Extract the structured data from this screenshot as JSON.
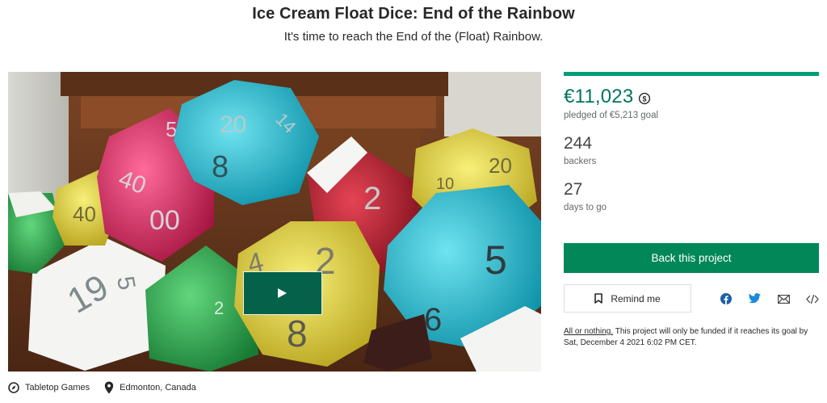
{
  "project": {
    "title": "Ice Cream Float Dice: End of the Rainbow",
    "blurb": "It's time to reach the End of the (Float) Rainbow."
  },
  "video": {
    "play_icon": "play-icon"
  },
  "category": {
    "icon": "compass-icon",
    "label": "Tabletop Games"
  },
  "location": {
    "icon": "map-pin-icon",
    "label": "Edmonton, Canada"
  },
  "stats": {
    "pledged": "€11,023",
    "currency_icon": "currency-conversion-icon",
    "goal_text": "pledged of €5,213 goal",
    "funded_fraction": 1.0,
    "backers_count": "244",
    "backers_label": "backers",
    "days_count": "27",
    "days_label": "days to go"
  },
  "actions": {
    "back_label": "Back this project",
    "remind_label": "Remind me",
    "remind_icon": "bookmark-icon"
  },
  "share": {
    "icons": [
      "facebook-icon",
      "twitter-icon",
      "email-icon",
      "embed-icon"
    ]
  },
  "funding_note": {
    "link": "All or nothing.",
    "text": " This project will only be funded if it reaches its goal by Sat, December 4 2021 6:02 PM CET."
  },
  "colors": {
    "brand_green": "#028858",
    "pledged_green": "#037362",
    "progress_green": "#009e74",
    "play_green": "#05614a"
  }
}
